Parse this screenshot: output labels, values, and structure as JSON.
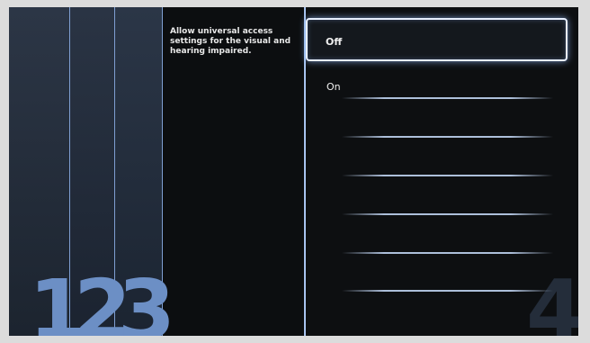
{
  "description": "Allow universal access settings for the visual and hearing impaired.",
  "column_numbers": [
    "1",
    "2",
    "3",
    "4"
  ],
  "options": [
    {
      "label": "Off",
      "selected": true
    },
    {
      "label": "On",
      "selected": false
    }
  ],
  "colors": {
    "accent_blue": "#6c8fc5",
    "highlight_border": "#e8f0ff",
    "background": "#0a0c0e"
  }
}
